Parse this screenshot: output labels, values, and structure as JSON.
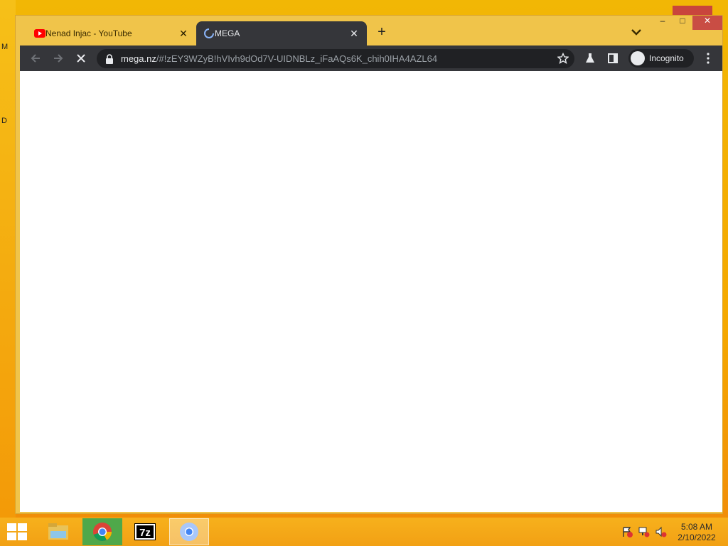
{
  "desktop": {
    "letters": [
      "M",
      "D"
    ]
  },
  "window_controls": {
    "min": "–",
    "max": "□",
    "close": "✕"
  },
  "tabs": [
    {
      "title": "Nenad Injac - YouTube",
      "close": "✕"
    },
    {
      "title": "MEGA",
      "close": "✕"
    }
  ],
  "new_tab": "+",
  "omnibox": {
    "host": "mega.nz",
    "path": "/#!zEY3WZyB!hVIvh9dOd7V-UIDNBLz_iFaAQs6K_chih0IHA4AZL64"
  },
  "incognito_label": "Incognito",
  "clock": {
    "time": "5:08 AM",
    "date": "2/10/2022"
  },
  "colors": {
    "toolbar": "#35363a",
    "accent_close": "#c94d44",
    "taskbar": "#f2a014"
  }
}
